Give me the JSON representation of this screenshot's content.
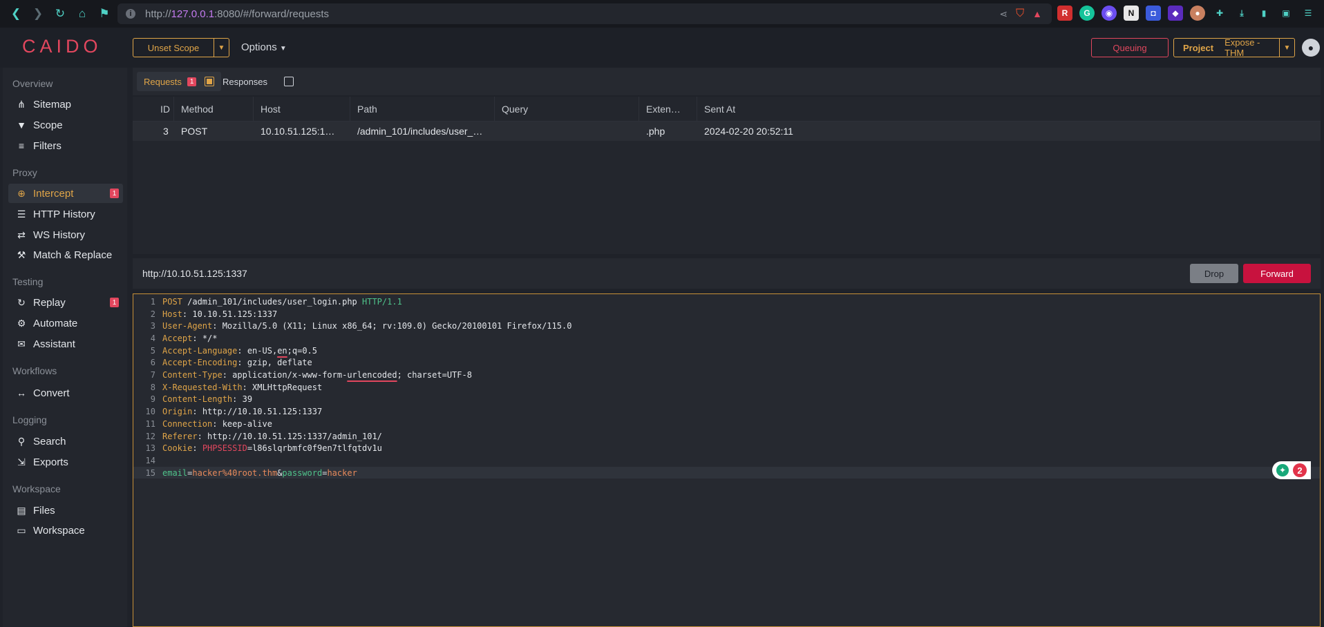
{
  "browser": {
    "url_prefix": "http://",
    "url_host": "127.0.0.1",
    "url_rest": ":8080/#/forward/requests"
  },
  "header": {
    "logo": "CAIDO",
    "scope_label": "Unset Scope",
    "options_label": "Options",
    "queuing_label": "Queuing",
    "project_label": "Project",
    "project_value": "Expose - THM"
  },
  "sidebar": {
    "sections": [
      {
        "title": "Overview",
        "items": [
          {
            "label": "Sitemap"
          },
          {
            "label": "Scope"
          },
          {
            "label": "Filters"
          }
        ]
      },
      {
        "title": "Proxy",
        "items": [
          {
            "label": "Intercept",
            "badge": "1"
          },
          {
            "label": "HTTP History"
          },
          {
            "label": "WS History"
          },
          {
            "label": "Match & Replace"
          }
        ]
      },
      {
        "title": "Testing",
        "items": [
          {
            "label": "Replay",
            "badge": "1"
          },
          {
            "label": "Automate"
          },
          {
            "label": "Assistant"
          }
        ]
      },
      {
        "title": "Workflows",
        "items": [
          {
            "label": "Convert"
          }
        ]
      },
      {
        "title": "Logging",
        "items": [
          {
            "label": "Search"
          },
          {
            "label": "Exports"
          }
        ]
      },
      {
        "title": "Workspace",
        "items": [
          {
            "label": "Files"
          },
          {
            "label": "Workspace"
          }
        ]
      }
    ]
  },
  "tabs": {
    "requests_label": "Requests",
    "requests_count": "1",
    "responses_label": "Responses"
  },
  "table": {
    "columns": [
      "ID",
      "Method",
      "Host",
      "Path",
      "Query",
      "Exten…",
      "Sent At"
    ],
    "rows": [
      {
        "id": "3",
        "method": "POST",
        "host": "10.10.51.125:1…",
        "path": "/admin_101/includes/user_…",
        "query": "",
        "ext": ".php",
        "sent_at": "2024-02-20 20:52:11"
      }
    ]
  },
  "request": {
    "url": "http://10.10.51.125:1337",
    "drop_label": "Drop",
    "forward_label": "Forward",
    "line_numbers": [
      "1",
      "2",
      "3",
      "4",
      "5",
      "6",
      "7",
      "8",
      "9",
      "10",
      "11",
      "12",
      "13",
      "14",
      "15"
    ],
    "lines": {
      "l1_method": "POST",
      "l1_path": " /admin_101/includes/user_login.php ",
      "l1_version": "HTTP/1.1",
      "h2_name": "Host",
      "h2_val": " 10.10.51.125:1337",
      "h3_name": "User-Agent",
      "h3_val": " Mozilla/5.0 (X11; Linux x86_64; rv:109.0) Gecko/20100101 Firefox/115.0",
      "h4_name": "Accept",
      "h4_val": " */*",
      "h5_name": "Accept-Language",
      "h5_val_a": " en-US,",
      "h5_val_b": "en",
      "h5_val_c": ";q=0.5",
      "h6_name": "Accept-Encoding",
      "h6_val": " gzip, deflate",
      "h7_name": "Content-Type",
      "h7_val_a": " application/x-www-form-",
      "h7_val_b": "urlencoded",
      "h7_val_c": "; charset=UTF-8",
      "h8_name": "X-Requested-With",
      "h8_val": " XMLHttpRequest",
      "h9_name": "Content-Length",
      "h9_val": " 39",
      "h10_name": "Origin",
      "h10_val": " http://10.10.51.125:1337",
      "h11_name": "Connection",
      "h11_val": " keep-alive",
      "h12_name": "Referer",
      "h12_val": " http://10.10.51.125:1337/admin_101/",
      "h13_name": "Cookie",
      "h13_cname": "PHPSESSID",
      "h13_val": "=l86slqrbmfc0f9en7tlfqtdv1u",
      "b_k1": "email",
      "b_eq1": "=",
      "b_v1": "hacker%40root.thm",
      "b_amp": "&",
      "b_k2": "password",
      "b_eq2": "=",
      "b_v2": "hacker"
    }
  },
  "widget": {
    "count": "2"
  }
}
